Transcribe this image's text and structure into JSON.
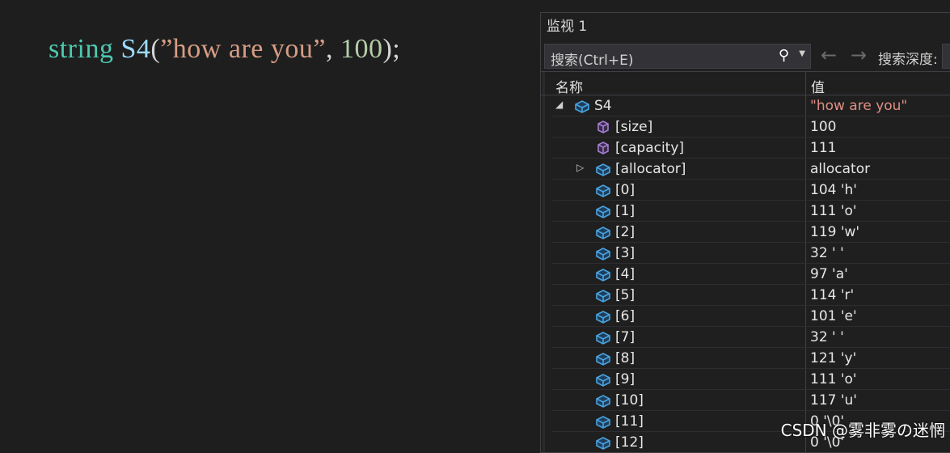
{
  "code": {
    "type": "string",
    "var": "S4",
    "open": "(",
    "literal": "”how are you”",
    "comma": ", ",
    "number": "100",
    "close": ");"
  },
  "watch": {
    "title": "监视 1",
    "search_placeholder": "搜索(Ctrl+E)",
    "depth_label": "搜索深度:",
    "col_name": "名称",
    "col_value": "值",
    "rows": [
      {
        "name": "S4",
        "value": "\"how are you\"",
        "expander": "◢",
        "icon": "object",
        "level": 0,
        "str": true
      },
      {
        "name": "[size]",
        "value": "100",
        "expander": "",
        "icon": "property",
        "level": 1
      },
      {
        "name": "[capacity]",
        "value": "111",
        "expander": "",
        "icon": "property",
        "level": 1
      },
      {
        "name": "[allocator]",
        "value": "allocator",
        "expander": "▷",
        "icon": "object",
        "level": 1
      },
      {
        "name": "[0]",
        "value": "104 'h'",
        "expander": "",
        "icon": "object",
        "level": 1
      },
      {
        "name": "[1]",
        "value": "111 'o'",
        "expander": "",
        "icon": "object",
        "level": 1
      },
      {
        "name": "[2]",
        "value": "119 'w'",
        "expander": "",
        "icon": "object",
        "level": 1
      },
      {
        "name": "[3]",
        "value": "32 ' '",
        "expander": "",
        "icon": "object",
        "level": 1
      },
      {
        "name": "[4]",
        "value": "97 'a'",
        "expander": "",
        "icon": "object",
        "level": 1
      },
      {
        "name": "[5]",
        "value": "114 'r'",
        "expander": "",
        "icon": "object",
        "level": 1
      },
      {
        "name": "[6]",
        "value": "101 'e'",
        "expander": "",
        "icon": "object",
        "level": 1
      },
      {
        "name": "[7]",
        "value": "32 ' '",
        "expander": "",
        "icon": "object",
        "level": 1
      },
      {
        "name": "[8]",
        "value": "121 'y'",
        "expander": "",
        "icon": "object",
        "level": 1
      },
      {
        "name": "[9]",
        "value": "111 'o'",
        "expander": "",
        "icon": "object",
        "level": 1
      },
      {
        "name": "[10]",
        "value": "117 'u'",
        "expander": "",
        "icon": "object",
        "level": 1
      },
      {
        "name": "[11]",
        "value": "0 '\\0'",
        "expander": "",
        "icon": "object",
        "level": 1
      },
      {
        "name": "[12]",
        "value": "0 '\\0'",
        "expander": "",
        "icon": "object",
        "level": 1
      }
    ]
  },
  "watermark": "CSDN @雾非雾の迷惘",
  "colors": {
    "type": "#4ec9b0",
    "variable": "#9cdcfe",
    "string": "#d69d85",
    "number": "#b5cea8",
    "string_value": "#e08f83"
  }
}
